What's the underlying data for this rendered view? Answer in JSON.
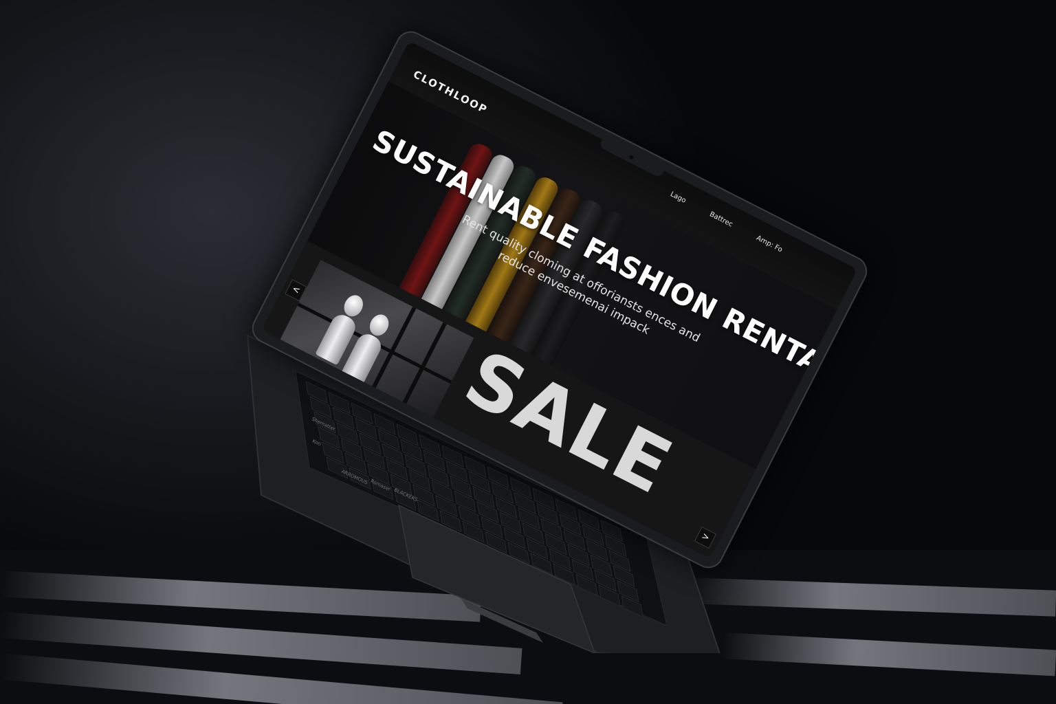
{
  "site": {
    "logo": "CLOTHLOOP",
    "nav": [
      "Lago",
      "Battrec",
      "Amp: Fo"
    ]
  },
  "hero": {
    "title": "SUSTAINABLE FASHION RENTALS",
    "subtitle": "Rent quality cloming at offoriansts ences and reduce envesemenai impack"
  },
  "promo": {
    "sale_text": "SALE",
    "prev_arrow": "<",
    "next_arrow": ">"
  },
  "keyboard": {
    "labels": [
      "Shematter",
      "Koti",
      "ARROMOUS",
      "Romaser",
      "BLACKERS"
    ]
  },
  "colors": {
    "background": "#07080a",
    "screen": "#0b0b0c",
    "text": "#ffffff",
    "sale": "#d9d9d9"
  }
}
